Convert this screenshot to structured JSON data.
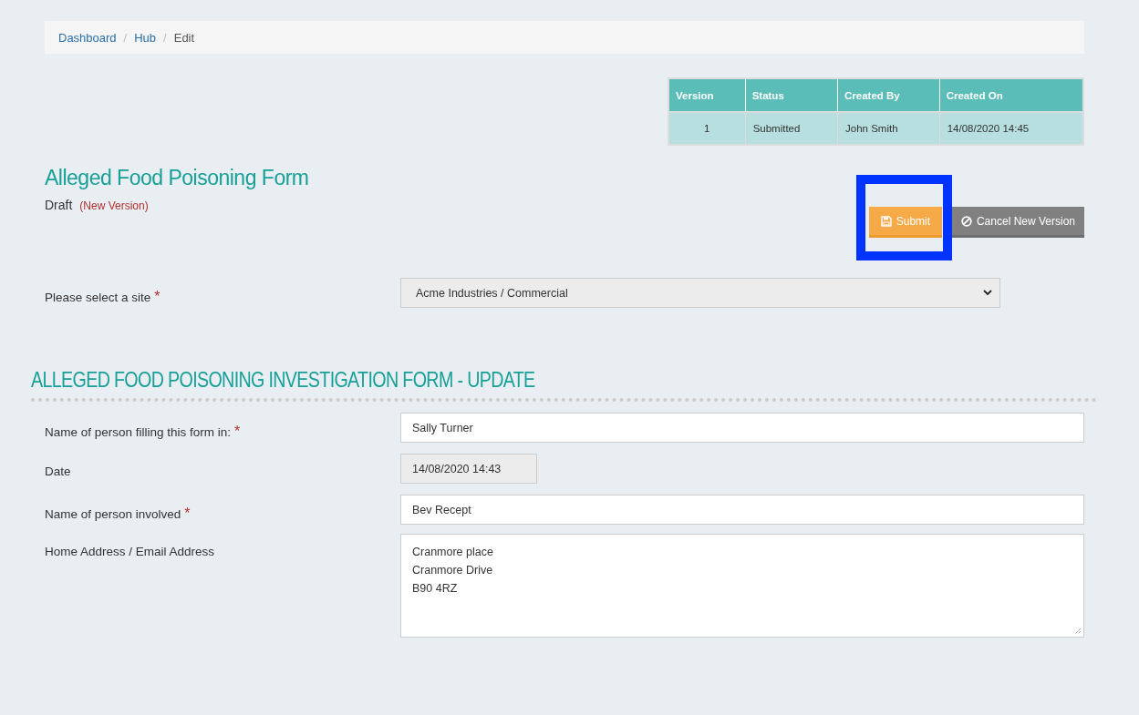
{
  "breadcrumb": [
    {
      "label": "Dashboard",
      "link": true
    },
    {
      "label": "Hub",
      "link": true
    },
    {
      "label": "Edit",
      "link": false
    }
  ],
  "breadcrumb_separator": "/",
  "versions_table": {
    "columns": [
      "Version",
      "Status",
      "Created By",
      "Created On"
    ],
    "rows": [
      [
        "1",
        "Submitted",
        "John Smith",
        "14/08/2020 14:45"
      ]
    ]
  },
  "form_title": "Alleged Food Poisoning Form",
  "status": "Draft",
  "status_note": "(New Version)",
  "buttons": [
    {
      "kind": "submit",
      "label": "Submit",
      "highlighted": true
    },
    {
      "kind": "cancel",
      "label": "Cancel New Version",
      "highlighted": false
    }
  ],
  "site": {
    "label": "Please select a site",
    "mark": "*",
    "value": "Acme Industries / Commercial"
  },
  "section_title": "ALLEGED FOOD POISONING INVESTIGATION FORM - UPDATE",
  "fields": [
    {
      "kind": "text",
      "label": "Name of person filling this form in:",
      "mark": "*",
      "value": "Sally Turner"
    },
    {
      "kind": "readonly",
      "label": "Date",
      "value": "14/08/2020 14:43"
    },
    {
      "kind": "text",
      "label": "Name of person involved",
      "mark": "*",
      "value": "Bev Recept"
    },
    {
      "kind": "textarea",
      "label": "Home Address / Email Address",
      "value": "Cranmore place\nCranmore Drive\nB90 4RZ"
    }
  ]
}
